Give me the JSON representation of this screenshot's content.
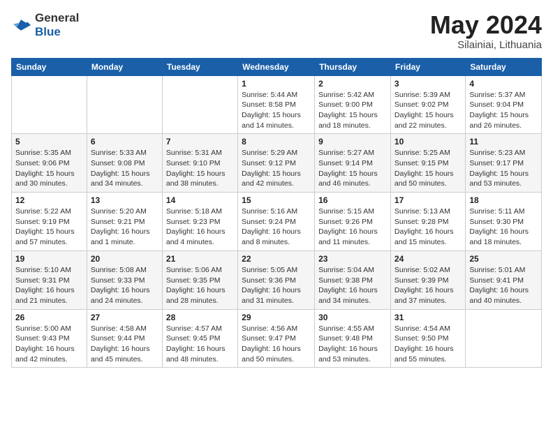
{
  "header": {
    "logo_general": "General",
    "logo_blue": "Blue",
    "month_title": "May 2024",
    "location": "Silainiai, Lithuania"
  },
  "weekdays": [
    "Sunday",
    "Monday",
    "Tuesday",
    "Wednesday",
    "Thursday",
    "Friday",
    "Saturday"
  ],
  "weeks": [
    [
      {
        "day": "",
        "sunrise": "",
        "sunset": "",
        "daylight": ""
      },
      {
        "day": "",
        "sunrise": "",
        "sunset": "",
        "daylight": ""
      },
      {
        "day": "",
        "sunrise": "",
        "sunset": "",
        "daylight": ""
      },
      {
        "day": "1",
        "sunrise": "Sunrise: 5:44 AM",
        "sunset": "Sunset: 8:58 PM",
        "daylight": "Daylight: 15 hours and 14 minutes."
      },
      {
        "day": "2",
        "sunrise": "Sunrise: 5:42 AM",
        "sunset": "Sunset: 9:00 PM",
        "daylight": "Daylight: 15 hours and 18 minutes."
      },
      {
        "day": "3",
        "sunrise": "Sunrise: 5:39 AM",
        "sunset": "Sunset: 9:02 PM",
        "daylight": "Daylight: 15 hours and 22 minutes."
      },
      {
        "day": "4",
        "sunrise": "Sunrise: 5:37 AM",
        "sunset": "Sunset: 9:04 PM",
        "daylight": "Daylight: 15 hours and 26 minutes."
      }
    ],
    [
      {
        "day": "5",
        "sunrise": "Sunrise: 5:35 AM",
        "sunset": "Sunset: 9:06 PM",
        "daylight": "Daylight: 15 hours and 30 minutes."
      },
      {
        "day": "6",
        "sunrise": "Sunrise: 5:33 AM",
        "sunset": "Sunset: 9:08 PM",
        "daylight": "Daylight: 15 hours and 34 minutes."
      },
      {
        "day": "7",
        "sunrise": "Sunrise: 5:31 AM",
        "sunset": "Sunset: 9:10 PM",
        "daylight": "Daylight: 15 hours and 38 minutes."
      },
      {
        "day": "8",
        "sunrise": "Sunrise: 5:29 AM",
        "sunset": "Sunset: 9:12 PM",
        "daylight": "Daylight: 15 hours and 42 minutes."
      },
      {
        "day": "9",
        "sunrise": "Sunrise: 5:27 AM",
        "sunset": "Sunset: 9:14 PM",
        "daylight": "Daylight: 15 hours and 46 minutes."
      },
      {
        "day": "10",
        "sunrise": "Sunrise: 5:25 AM",
        "sunset": "Sunset: 9:15 PM",
        "daylight": "Daylight: 15 hours and 50 minutes."
      },
      {
        "day": "11",
        "sunrise": "Sunrise: 5:23 AM",
        "sunset": "Sunset: 9:17 PM",
        "daylight": "Daylight: 15 hours and 53 minutes."
      }
    ],
    [
      {
        "day": "12",
        "sunrise": "Sunrise: 5:22 AM",
        "sunset": "Sunset: 9:19 PM",
        "daylight": "Daylight: 15 hours and 57 minutes."
      },
      {
        "day": "13",
        "sunrise": "Sunrise: 5:20 AM",
        "sunset": "Sunset: 9:21 PM",
        "daylight": "Daylight: 16 hours and 1 minute."
      },
      {
        "day": "14",
        "sunrise": "Sunrise: 5:18 AM",
        "sunset": "Sunset: 9:23 PM",
        "daylight": "Daylight: 16 hours and 4 minutes."
      },
      {
        "day": "15",
        "sunrise": "Sunrise: 5:16 AM",
        "sunset": "Sunset: 9:24 PM",
        "daylight": "Daylight: 16 hours and 8 minutes."
      },
      {
        "day": "16",
        "sunrise": "Sunrise: 5:15 AM",
        "sunset": "Sunset: 9:26 PM",
        "daylight": "Daylight: 16 hours and 11 minutes."
      },
      {
        "day": "17",
        "sunrise": "Sunrise: 5:13 AM",
        "sunset": "Sunset: 9:28 PM",
        "daylight": "Daylight: 16 hours and 15 minutes."
      },
      {
        "day": "18",
        "sunrise": "Sunrise: 5:11 AM",
        "sunset": "Sunset: 9:30 PM",
        "daylight": "Daylight: 16 hours and 18 minutes."
      }
    ],
    [
      {
        "day": "19",
        "sunrise": "Sunrise: 5:10 AM",
        "sunset": "Sunset: 9:31 PM",
        "daylight": "Daylight: 16 hours and 21 minutes."
      },
      {
        "day": "20",
        "sunrise": "Sunrise: 5:08 AM",
        "sunset": "Sunset: 9:33 PM",
        "daylight": "Daylight: 16 hours and 24 minutes."
      },
      {
        "day": "21",
        "sunrise": "Sunrise: 5:06 AM",
        "sunset": "Sunset: 9:35 PM",
        "daylight": "Daylight: 16 hours and 28 minutes."
      },
      {
        "day": "22",
        "sunrise": "Sunrise: 5:05 AM",
        "sunset": "Sunset: 9:36 PM",
        "daylight": "Daylight: 16 hours and 31 minutes."
      },
      {
        "day": "23",
        "sunrise": "Sunrise: 5:04 AM",
        "sunset": "Sunset: 9:38 PM",
        "daylight": "Daylight: 16 hours and 34 minutes."
      },
      {
        "day": "24",
        "sunrise": "Sunrise: 5:02 AM",
        "sunset": "Sunset: 9:39 PM",
        "daylight": "Daylight: 16 hours and 37 minutes."
      },
      {
        "day": "25",
        "sunrise": "Sunrise: 5:01 AM",
        "sunset": "Sunset: 9:41 PM",
        "daylight": "Daylight: 16 hours and 40 minutes."
      }
    ],
    [
      {
        "day": "26",
        "sunrise": "Sunrise: 5:00 AM",
        "sunset": "Sunset: 9:43 PM",
        "daylight": "Daylight: 16 hours and 42 minutes."
      },
      {
        "day": "27",
        "sunrise": "Sunrise: 4:58 AM",
        "sunset": "Sunset: 9:44 PM",
        "daylight": "Daylight: 16 hours and 45 minutes."
      },
      {
        "day": "28",
        "sunrise": "Sunrise: 4:57 AM",
        "sunset": "Sunset: 9:45 PM",
        "daylight": "Daylight: 16 hours and 48 minutes."
      },
      {
        "day": "29",
        "sunrise": "Sunrise: 4:56 AM",
        "sunset": "Sunset: 9:47 PM",
        "daylight": "Daylight: 16 hours and 50 minutes."
      },
      {
        "day": "30",
        "sunrise": "Sunrise: 4:55 AM",
        "sunset": "Sunset: 9:48 PM",
        "daylight": "Daylight: 16 hours and 53 minutes."
      },
      {
        "day": "31",
        "sunrise": "Sunrise: 4:54 AM",
        "sunset": "Sunset: 9:50 PM",
        "daylight": "Daylight: 16 hours and 55 minutes."
      },
      {
        "day": "",
        "sunrise": "",
        "sunset": "",
        "daylight": ""
      }
    ]
  ]
}
